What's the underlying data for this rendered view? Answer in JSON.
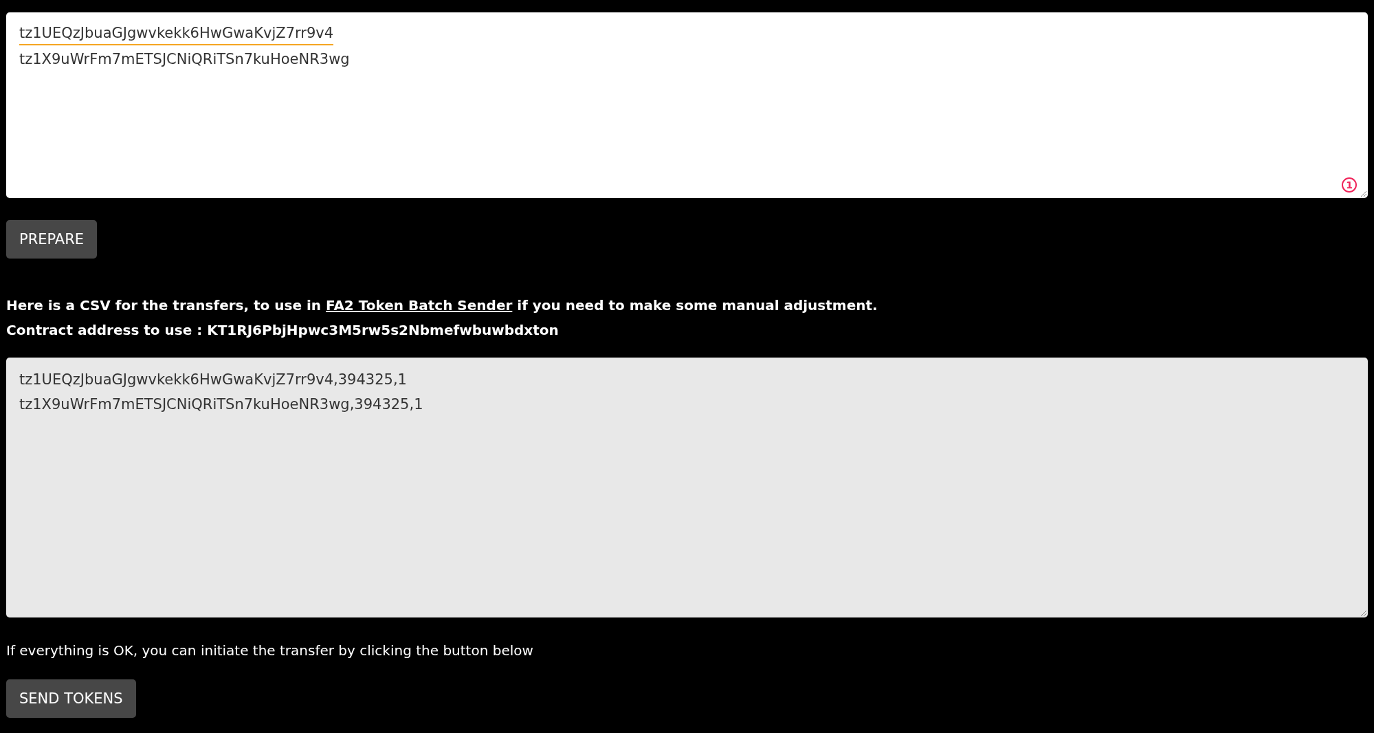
{
  "address_input": {
    "lines": [
      {
        "text": "tz1UEQzJbuaGJgwvkekk6HwGwaKvjZ7rr9v4",
        "flagged": true
      },
      {
        "text": "tz1X9uWrFm7mETSJCNiQRiTSn7kuHoeNR3wg",
        "flagged": false
      }
    ],
    "issue_count": "1"
  },
  "prepare_button": "PREPARE",
  "csv_intro": {
    "before": "Here is a CSV for the transfers, to use in ",
    "link": "FA2 Token Batch Sender",
    "after": " if you need to make some manual adjustment."
  },
  "contract_line": "Contract address to use : KT1RJ6PbjHpwc3M5rw5s2Nbmefwbuwbdxton",
  "csv_output": {
    "lines": [
      "tz1UEQzJbuaGJgwvkekk6HwGwaKvjZ7rr9v4,394325,1",
      "tz1X9uWrFm7mETSJCNiQRiTSn7kuHoeNR3wg,394325,1"
    ]
  },
  "send_note": "If everything is OK, you can initiate the transfer by clicking the button below",
  "send_button": "SEND TOKENS"
}
